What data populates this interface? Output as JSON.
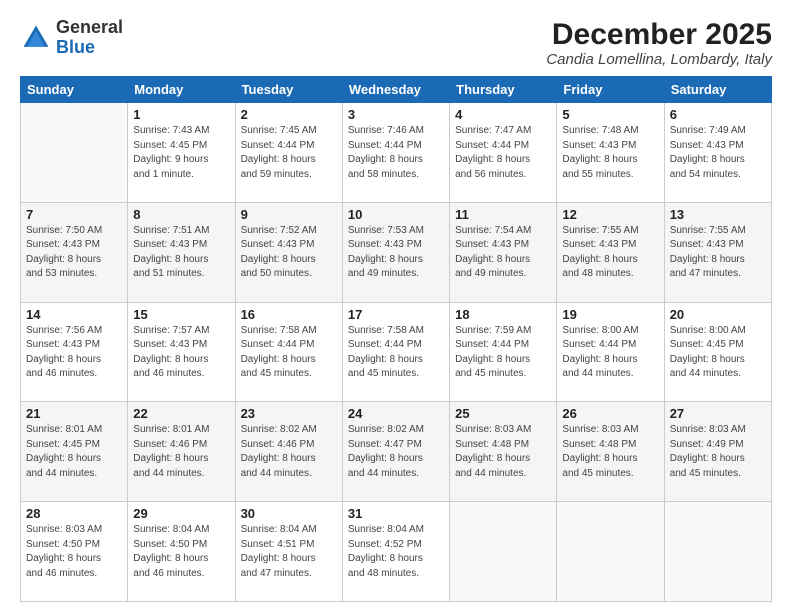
{
  "logo": {
    "general": "General",
    "blue": "Blue"
  },
  "title": {
    "month_year": "December 2025",
    "location": "Candia Lomellina, Lombardy, Italy"
  },
  "days_of_week": [
    "Sunday",
    "Monday",
    "Tuesday",
    "Wednesday",
    "Thursday",
    "Friday",
    "Saturday"
  ],
  "weeks": [
    [
      {
        "day": "",
        "info": ""
      },
      {
        "day": "1",
        "info": "Sunrise: 7:43 AM\nSunset: 4:45 PM\nDaylight: 9 hours\nand 1 minute."
      },
      {
        "day": "2",
        "info": "Sunrise: 7:45 AM\nSunset: 4:44 PM\nDaylight: 8 hours\nand 59 minutes."
      },
      {
        "day": "3",
        "info": "Sunrise: 7:46 AM\nSunset: 4:44 PM\nDaylight: 8 hours\nand 58 minutes."
      },
      {
        "day": "4",
        "info": "Sunrise: 7:47 AM\nSunset: 4:44 PM\nDaylight: 8 hours\nand 56 minutes."
      },
      {
        "day": "5",
        "info": "Sunrise: 7:48 AM\nSunset: 4:43 PM\nDaylight: 8 hours\nand 55 minutes."
      },
      {
        "day": "6",
        "info": "Sunrise: 7:49 AM\nSunset: 4:43 PM\nDaylight: 8 hours\nand 54 minutes."
      }
    ],
    [
      {
        "day": "7",
        "info": "Sunrise: 7:50 AM\nSunset: 4:43 PM\nDaylight: 8 hours\nand 53 minutes."
      },
      {
        "day": "8",
        "info": "Sunrise: 7:51 AM\nSunset: 4:43 PM\nDaylight: 8 hours\nand 51 minutes."
      },
      {
        "day": "9",
        "info": "Sunrise: 7:52 AM\nSunset: 4:43 PM\nDaylight: 8 hours\nand 50 minutes."
      },
      {
        "day": "10",
        "info": "Sunrise: 7:53 AM\nSunset: 4:43 PM\nDaylight: 8 hours\nand 49 minutes."
      },
      {
        "day": "11",
        "info": "Sunrise: 7:54 AM\nSunset: 4:43 PM\nDaylight: 8 hours\nand 49 minutes."
      },
      {
        "day": "12",
        "info": "Sunrise: 7:55 AM\nSunset: 4:43 PM\nDaylight: 8 hours\nand 48 minutes."
      },
      {
        "day": "13",
        "info": "Sunrise: 7:55 AM\nSunset: 4:43 PM\nDaylight: 8 hours\nand 47 minutes."
      }
    ],
    [
      {
        "day": "14",
        "info": "Sunrise: 7:56 AM\nSunset: 4:43 PM\nDaylight: 8 hours\nand 46 minutes."
      },
      {
        "day": "15",
        "info": "Sunrise: 7:57 AM\nSunset: 4:43 PM\nDaylight: 8 hours\nand 46 minutes."
      },
      {
        "day": "16",
        "info": "Sunrise: 7:58 AM\nSunset: 4:44 PM\nDaylight: 8 hours\nand 45 minutes."
      },
      {
        "day": "17",
        "info": "Sunrise: 7:58 AM\nSunset: 4:44 PM\nDaylight: 8 hours\nand 45 minutes."
      },
      {
        "day": "18",
        "info": "Sunrise: 7:59 AM\nSunset: 4:44 PM\nDaylight: 8 hours\nand 45 minutes."
      },
      {
        "day": "19",
        "info": "Sunrise: 8:00 AM\nSunset: 4:44 PM\nDaylight: 8 hours\nand 44 minutes."
      },
      {
        "day": "20",
        "info": "Sunrise: 8:00 AM\nSunset: 4:45 PM\nDaylight: 8 hours\nand 44 minutes."
      }
    ],
    [
      {
        "day": "21",
        "info": "Sunrise: 8:01 AM\nSunset: 4:45 PM\nDaylight: 8 hours\nand 44 minutes."
      },
      {
        "day": "22",
        "info": "Sunrise: 8:01 AM\nSunset: 4:46 PM\nDaylight: 8 hours\nand 44 minutes."
      },
      {
        "day": "23",
        "info": "Sunrise: 8:02 AM\nSunset: 4:46 PM\nDaylight: 8 hours\nand 44 minutes."
      },
      {
        "day": "24",
        "info": "Sunrise: 8:02 AM\nSunset: 4:47 PM\nDaylight: 8 hours\nand 44 minutes."
      },
      {
        "day": "25",
        "info": "Sunrise: 8:03 AM\nSunset: 4:48 PM\nDaylight: 8 hours\nand 44 minutes."
      },
      {
        "day": "26",
        "info": "Sunrise: 8:03 AM\nSunset: 4:48 PM\nDaylight: 8 hours\nand 45 minutes."
      },
      {
        "day": "27",
        "info": "Sunrise: 8:03 AM\nSunset: 4:49 PM\nDaylight: 8 hours\nand 45 minutes."
      }
    ],
    [
      {
        "day": "28",
        "info": "Sunrise: 8:03 AM\nSunset: 4:50 PM\nDaylight: 8 hours\nand 46 minutes."
      },
      {
        "day": "29",
        "info": "Sunrise: 8:04 AM\nSunset: 4:50 PM\nDaylight: 8 hours\nand 46 minutes."
      },
      {
        "day": "30",
        "info": "Sunrise: 8:04 AM\nSunset: 4:51 PM\nDaylight: 8 hours\nand 47 minutes."
      },
      {
        "day": "31",
        "info": "Sunrise: 8:04 AM\nSunset: 4:52 PM\nDaylight: 8 hours\nand 48 minutes."
      },
      {
        "day": "",
        "info": ""
      },
      {
        "day": "",
        "info": ""
      },
      {
        "day": "",
        "info": ""
      }
    ]
  ]
}
